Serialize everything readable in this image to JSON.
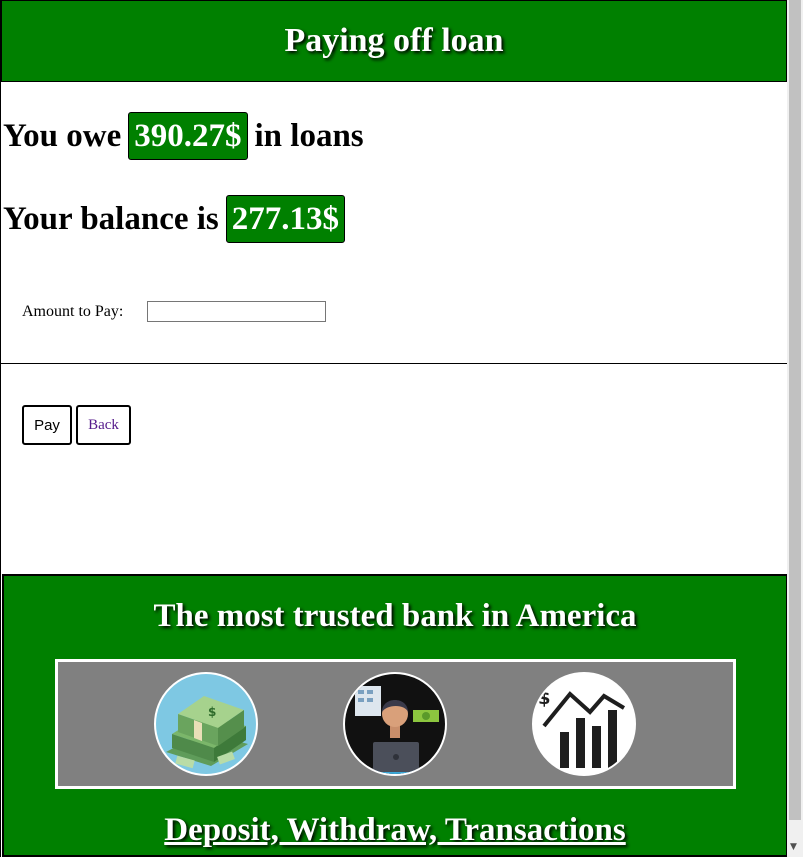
{
  "header": {
    "title": "Paying off loan"
  },
  "owe": {
    "prefix": "You owe",
    "amount": "390.27$",
    "suffix": "in loans"
  },
  "balance": {
    "prefix": "Your balance is",
    "amount": "277.13$"
  },
  "form": {
    "amount_label": "Amount to Pay:",
    "amount_value": ""
  },
  "buttons": {
    "pay": "Pay",
    "back": "Back"
  },
  "footer": {
    "title": "The most trusted bank in America",
    "icons": [
      "money-stack-icon",
      "banker-laptop-icon",
      "stock-chart-icon"
    ],
    "links_text": "Deposit, Withdraw, Transactions"
  },
  "colors": {
    "brand_green": "#008000",
    "panel_gray": "#808080",
    "link_visited": "#551a8b"
  }
}
